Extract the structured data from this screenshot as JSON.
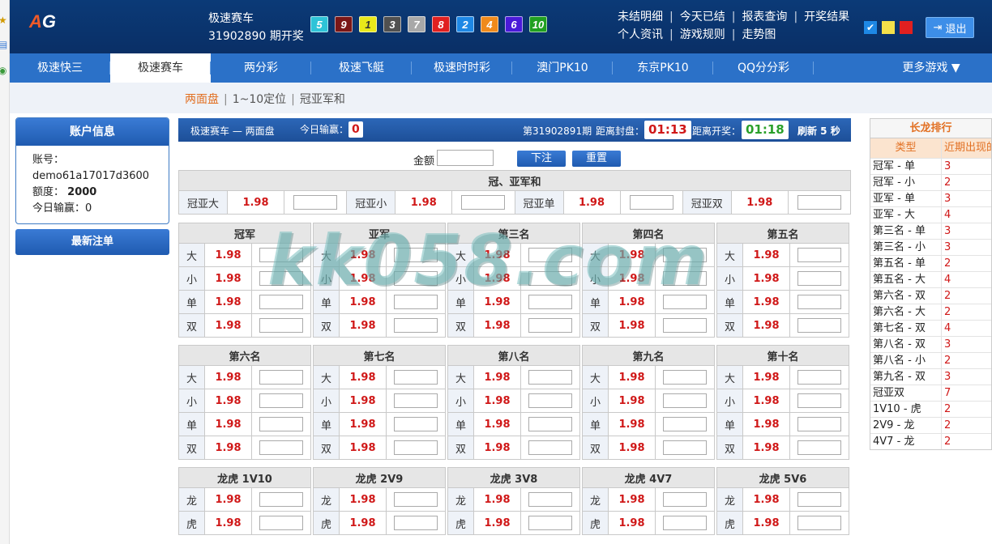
{
  "header": {
    "logo": "AG",
    "game_name": "极速赛车",
    "draw_text": "31902890 期开奖",
    "balls": [
      {
        "n": "5",
        "color": "#2ec3d8"
      },
      {
        "n": "9",
        "color": "#7a1616"
      },
      {
        "n": "1",
        "color": "#e8e81a"
      },
      {
        "n": "3",
        "color": "#505050"
      },
      {
        "n": "7",
        "color": "#a8a8a8"
      },
      {
        "n": "8",
        "color": "#e02020"
      },
      {
        "n": "2",
        "color": "#1e88e5"
      },
      {
        "n": "4",
        "color": "#f08a1c"
      },
      {
        "n": "6",
        "color": "#4a1ad8"
      },
      {
        "n": "10",
        "color": "#20a020"
      }
    ],
    "links_row1": [
      "未结明细",
      "今天已结",
      "报表查询",
      "开奖结果"
    ],
    "links_row2": [
      "个人资讯",
      "游戏规则",
      "走势图"
    ],
    "logout": "退出",
    "swatches": [
      "#1e88e5",
      "#f4e04a",
      "#e02020"
    ]
  },
  "nav": [
    "极速快三",
    "极速赛车",
    "两分彩",
    "极速飞艇",
    "极速时时彩",
    "澳门PK10",
    "东京PK10",
    "QQ分分彩",
    "更多游戏 ▼"
  ],
  "subnav": [
    "两面盘",
    "1~10定位",
    "冠亚军和"
  ],
  "account": {
    "title": "账户信息",
    "account_label": "账号：",
    "account_value": "demo61a17017d3600",
    "credit_label": "额度：",
    "credit_value": "2000",
    "today_label": "今日输赢：",
    "today_value": "0",
    "latest_btn": "最新注单"
  },
  "infobar": {
    "title": "极速赛车 — 两面盘",
    "today_label": "今日输赢：",
    "today_value": "0",
    "period": "第31902891期",
    "close_label": "距离封盘：",
    "close_time": "01:13",
    "open_label": "距离开奖：",
    "open_time": "01:18",
    "refresh": "刷新 5 秒"
  },
  "amount": {
    "label": "金额",
    "submit": "下注",
    "reset": "重置"
  },
  "gyh": {
    "title": "冠、亚军和",
    "items": [
      {
        "label": "冠亚大",
        "odds": "1.98"
      },
      {
        "label": "冠亚小",
        "odds": "1.98"
      },
      {
        "label": "冠亚单",
        "odds": "1.98"
      },
      {
        "label": "冠亚双",
        "odds": "1.98"
      }
    ]
  },
  "positions1": [
    "冠军",
    "亚军",
    "第三名",
    "第四名",
    "第五名"
  ],
  "positions2": [
    "第六名",
    "第七名",
    "第八名",
    "第九名",
    "第十名"
  ],
  "bigsmall": [
    "大",
    "小",
    "单",
    "双"
  ],
  "dragon_titles": [
    "龙虎 1V10",
    "龙虎 2V9",
    "龙虎 3V8",
    "龙虎 4V7",
    "龙虎 5V6"
  ],
  "dragon_labels": [
    "龙",
    "虎"
  ],
  "odds": "1.98",
  "watermark": "kk058.com",
  "ranking": {
    "title": "长龙排行",
    "col1": "类型",
    "col2": "近期出现的",
    "rows": [
      {
        "type": "冠军 - 单",
        "count": "3"
      },
      {
        "type": "冠军 - 小",
        "count": "2"
      },
      {
        "type": "亚军 - 单",
        "count": "3"
      },
      {
        "type": "亚军 - 大",
        "count": "4"
      },
      {
        "type": "第三名 - 单",
        "count": "3"
      },
      {
        "type": "第三名 - 小",
        "count": "3"
      },
      {
        "type": "第五名 - 单",
        "count": "2"
      },
      {
        "type": "第五名 - 大",
        "count": "4"
      },
      {
        "type": "第六名 - 双",
        "count": "2"
      },
      {
        "type": "第六名 - 大",
        "count": "2"
      },
      {
        "type": "第七名 - 双",
        "count": "4"
      },
      {
        "type": "第八名 - 双",
        "count": "3"
      },
      {
        "type": "第八名 - 小",
        "count": "2"
      },
      {
        "type": "第九名 - 双",
        "count": "3"
      },
      {
        "type": "冠亚双",
        "count": "7"
      },
      {
        "type": "1V10 - 虎",
        "count": "2"
      },
      {
        "type": "2V9 - 龙",
        "count": "2"
      },
      {
        "type": "4V7 - 龙",
        "count": "2"
      }
    ]
  }
}
